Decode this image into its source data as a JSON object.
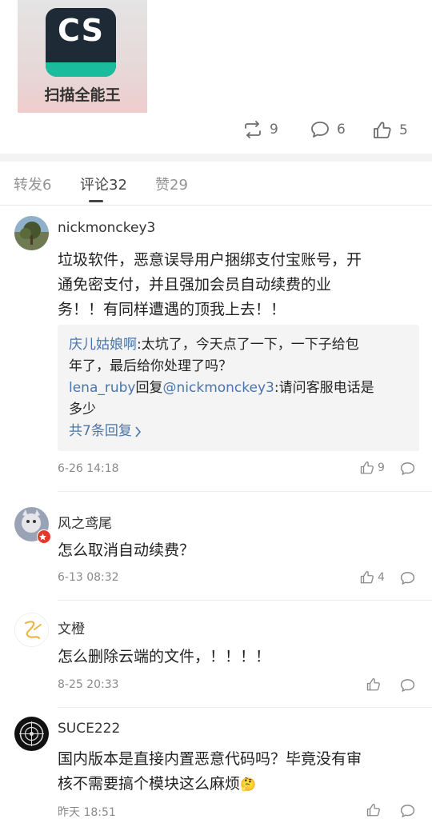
{
  "post": {
    "app_icon_text": "CS",
    "app_name": "扫描全能王",
    "repost_count": "9",
    "comment_count": "6",
    "like_count": "5"
  },
  "tabs": [
    {
      "label": "转发6"
    },
    {
      "label": "评论32"
    },
    {
      "label": "赞29"
    }
  ],
  "comments": [
    {
      "name": "nickmonckey3",
      "text_lines": [
        "垃圾软件，恶意误导用户捆绑支付宝账号，开",
        "通免密支付，并且强加会员自动续费的业",
        "务！！有同样遭遇的顶我上去！！"
      ],
      "time": "6-26 14:18",
      "likes": "9",
      "replies": {
        "r1_user": "庆儿姑娘啊",
        "r1_text_a": ":太坑了，今天点了一下，一下子给包",
        "r1_text_b": "年了，最后给你处理了吗？",
        "r2_user": "lena_ruby",
        "r2_mid": "回复",
        "r2_mention": "@nickmonckey3",
        "r2_text_a": ":请问客服电话是",
        "r2_text_b": "多少",
        "more_label": "共7条回复"
      }
    },
    {
      "name": "风之鸢尾",
      "text_lines": [
        "怎么取消自动续费？"
      ],
      "time": "6-13 08:32",
      "likes": "4"
    },
    {
      "name": "文橙",
      "text_lines": [
        "怎么删除云端的文件，！！！！"
      ],
      "time": "8-25 20:33",
      "likes": ""
    },
    {
      "name": "SUCE222",
      "text_lines": [
        "国内版本是直接内置恶意代码吗？毕竟没有审",
        "核不需要搞个模块这么麻烦"
      ],
      "emoji": "🤔",
      "time": "昨天 18:51",
      "likes": ""
    }
  ],
  "colors": {
    "link": "#4a75a8",
    "meta": "#8a8a8a",
    "badge": "#e5382d",
    "brand_band": "#19bc9c"
  }
}
